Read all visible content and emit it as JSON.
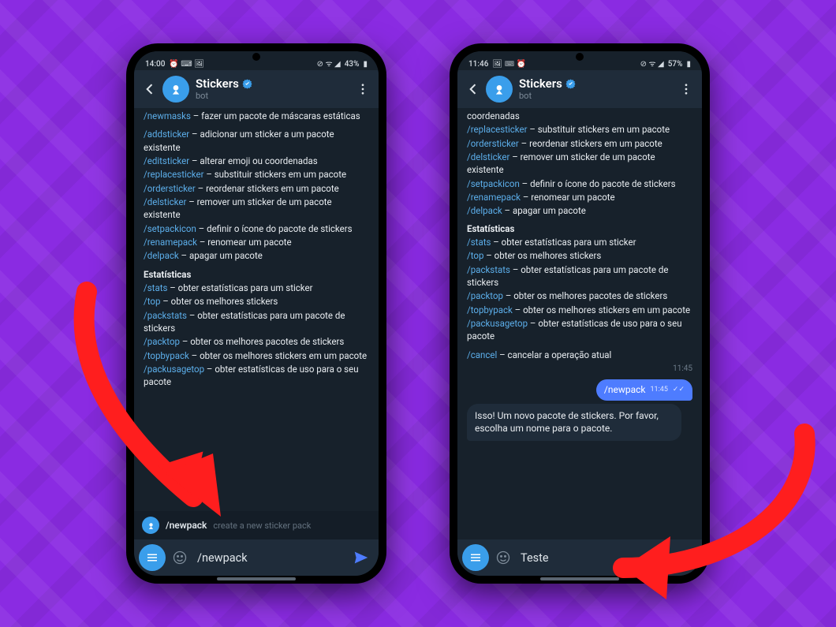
{
  "phone1": {
    "status": {
      "time": "14:00",
      "battery": "43%",
      "icons": "◷ ▭ ▭",
      "right": "◎ ▤ ◢"
    },
    "header": {
      "title": "Stickers",
      "subtitle": "bot"
    },
    "msg": [
      {
        "cmd": "/newmasks",
        "text": " – fazer um pacote de máscaras estáticas"
      },
      {
        "blank": true
      },
      {
        "cmd": "/addsticker",
        "text": " – adicionar um sticker a um pacote existente"
      },
      {
        "cmd": "/editsticker",
        "text": " – alterar emoji ou coordenadas"
      },
      {
        "cmd": "/replacesticker",
        "text": " – substituir stickers em um pacote"
      },
      {
        "cmd": "/ordersticker",
        "text": " – reordenar stickers em um pacote"
      },
      {
        "cmd": "/delsticker",
        "text": " – remover um sticker de um pacote existente"
      },
      {
        "cmd": "/setpackicon",
        "text": " – definir o ícone do pacote de stickers"
      },
      {
        "cmd": "/renamepack",
        "text": " – renomear um pacote"
      },
      {
        "cmd": "/delpack",
        "text": " – apagar um pacote"
      },
      {
        "section": "Estatísticas"
      },
      {
        "cmd": "/stats",
        "text": " – obter estatísticas para um sticker"
      },
      {
        "cmd": "/top",
        "text": " – obter os melhores stickers"
      },
      {
        "cmd": "/packstats",
        "text": " – obter estatísticas para um pacote de stickers"
      },
      {
        "cmd": "/packtop",
        "text": " – obter os melhores pacotes de stickers"
      },
      {
        "cmd": "/topbypack",
        "text": " – obter os melhores stickers em um pacote"
      },
      {
        "cmd": "/packusagetop",
        "text": " – obter estatísticas de uso para o seu pacote"
      }
    ],
    "suggest": {
      "cmd": "/newpack",
      "desc": "create a new sticker pack"
    },
    "input": "/newpack"
  },
  "phone2": {
    "status": {
      "time": "11:46",
      "battery": "57%",
      "icons": "▭ ▭ ◷",
      "right": "◎ ▤ ◢"
    },
    "header": {
      "title": "Stickers",
      "subtitle": "bot"
    },
    "msg": [
      {
        "cmdonly": false,
        "text": "coordenadas"
      },
      {
        "cmd": "/replacesticker",
        "text": " – substituir stickers em um pacote"
      },
      {
        "cmd": "/ordersticker",
        "text": " – reordenar stickers em um pacote"
      },
      {
        "cmd": "/delsticker",
        "text": " – remover um sticker de um pacote existente"
      },
      {
        "cmd": "/setpackicon",
        "text": " – definir o ícone do pacote de stickers"
      },
      {
        "cmd": "/renamepack",
        "text": " – renomear um pacote"
      },
      {
        "cmd": "/delpack",
        "text": " – apagar um pacote"
      },
      {
        "section": "Estatísticas"
      },
      {
        "cmd": "/stats",
        "text": " – obter estatísticas para um sticker"
      },
      {
        "cmd": "/top",
        "text": " – obter os melhores stickers"
      },
      {
        "cmd": "/packstats",
        "text": " – obter estatísticas para um pacote de stickers"
      },
      {
        "cmd": "/packtop",
        "text": " – obter os melhores pacotes de stickers"
      },
      {
        "cmd": "/topbypack",
        "text": " – obter os melhores stickers em um pacote"
      },
      {
        "cmd": "/packusagetop",
        "text": " – obter estatísticas de uso para o seu pacote"
      },
      {
        "blank": true
      },
      {
        "cmd": "/cancel",
        "text": " – cancelar a operação atual"
      }
    ],
    "msg_time": "11:45",
    "sent": {
      "text": "/newpack",
      "time": "11:45"
    },
    "reply": "Isso! Um novo pacote de stickers. Por favor, escolha um nome para o pacote.",
    "input": "Teste"
  }
}
